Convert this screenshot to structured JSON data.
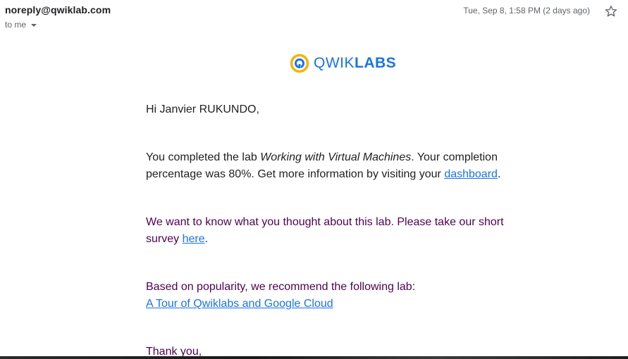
{
  "header": {
    "sender": "noreply@qwiklab.com",
    "recipient_label": "to me",
    "timestamp": "Tue, Sep 8, 1:58 PM (2 days ago)"
  },
  "logo": {
    "text_light": "QWIK",
    "text_bold": "LABS",
    "icon": "qwiklabs-logo-icon"
  },
  "message": {
    "greeting": "Hi Janvier RUKUNDO,",
    "para1_prefix": "You completed the lab ",
    "lab_name": "Working with Virtual Machines",
    "para1_middle": ". Your completion percentage was 80%. Get more information by visiting your ",
    "dashboard_link": "dashboard",
    "para1_suffix": ".",
    "para2_prefix": "We want to know what you thought about this lab. Please take our short survey ",
    "survey_link": "here",
    "para2_suffix": ".",
    "para3_text": "Based on popularity, we recommend the following lab:",
    "recommended_link": "A Tour of Qwiklabs and Google Cloud",
    "closing": "Thank you,"
  },
  "colors": {
    "link": "#1a73e8",
    "logo_yellow": "#f4b400",
    "logo_blue": "#1a73e8",
    "quoted_text": "#500050"
  }
}
